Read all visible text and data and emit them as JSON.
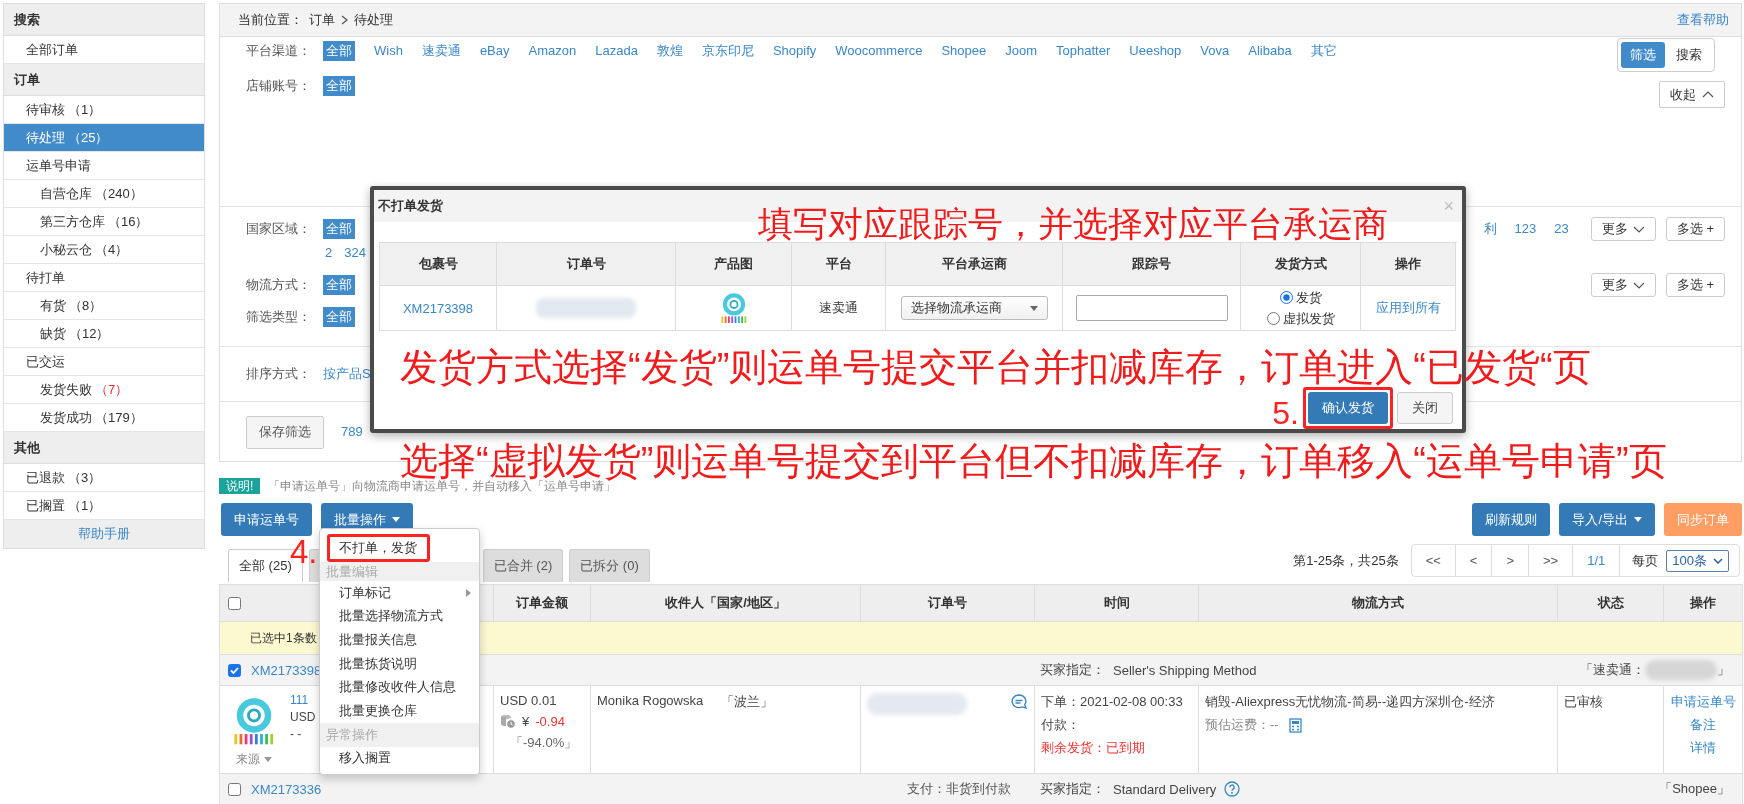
{
  "sidebar": {
    "sections": [
      {
        "title": "搜索",
        "items": [
          {
            "label": "全部订单",
            "selected": false,
            "alert": false
          }
        ]
      },
      {
        "title": "订单",
        "items": [
          {
            "label": "待审核",
            "count": "（1）",
            "selected": false,
            "alert": false
          },
          {
            "label": "待处理",
            "count": "（25）",
            "selected": true,
            "alert": false
          },
          {
            "label": "运单号申请",
            "selected": false,
            "alert": false,
            "children": [
              {
                "label": "自营仓库",
                "count": "（240）",
                "selected": false,
                "alert": false
              },
              {
                "label": "第三方仓库",
                "count": "（16）",
                "selected": false,
                "alert": false
              },
              {
                "label": "小秘云仓",
                "count": "（4）",
                "selected": false,
                "alert": false
              }
            ]
          },
          {
            "label": "待打单",
            "selected": false,
            "alert": false,
            "children": [
              {
                "label": "有货",
                "count": "（8）",
                "selected": false,
                "alert": false
              },
              {
                "label": "缺货",
                "count": "（12）",
                "selected": false,
                "alert": false
              }
            ]
          },
          {
            "label": "已交运",
            "selected": false,
            "alert": false,
            "children": [
              {
                "label": "发货失败",
                "count": "（7）",
                "selected": false,
                "alert": true
              },
              {
                "label": "发货成功",
                "count": "（179）",
                "selected": false,
                "alert": false
              }
            ]
          }
        ]
      },
      {
        "title": "其他",
        "items": [
          {
            "label": "已退款",
            "count": "（3）",
            "selected": false,
            "alert": false
          },
          {
            "label": "已搁置",
            "count": "（1）",
            "selected": false,
            "alert": false
          }
        ]
      }
    ],
    "help": "帮助手册"
  },
  "filters": {
    "breadcrumb": {
      "label": "当前位置：",
      "path": [
        "订单",
        "待处理"
      ]
    },
    "help": "查看帮助",
    "view_switch": [
      {
        "label": "筛选",
        "selected": true
      },
      {
        "label": "搜索",
        "selected": false
      }
    ],
    "collapse": "收起",
    "groups": [
      {
        "kind": "rows",
        "rows": [
          {
            "label": "平台渠道：",
            "options": [
              {
                "text": "全部",
                "selected": true
              },
              {
                "text": "Wish",
                "selected": false
              },
              {
                "text": "速卖通",
                "selected": false
              },
              {
                "text": "eBay",
                "selected": false
              },
              {
                "text": "Amazon",
                "selected": false
              },
              {
                "text": "Lazada",
                "selected": false
              },
              {
                "text": "敦煌",
                "selected": false
              },
              {
                "text": "京东印尼",
                "selected": false
              },
              {
                "text": "Shopify",
                "selected": false
              },
              {
                "text": "Woocommerce",
                "selected": false
              },
              {
                "text": "Shopee",
                "selected": false
              },
              {
                "text": "Joom",
                "selected": false
              },
              {
                "text": "Tophatter",
                "selected": false
              },
              {
                "text": "Ueeshop",
                "selected": false
              },
              {
                "text": "Vova",
                "selected": false
              },
              {
                "text": "Alibaba",
                "selected": false
              },
              {
                "text": "其它",
                "selected": false
              }
            ]
          },
          {
            "label": "店铺账号：",
            "options": [
              {
                "text": "全部",
                "selected": true
              }
            ]
          }
        ]
      },
      {
        "kind": "rows",
        "rows": [
          {
            "label": "国家区域：",
            "options": [
              {
                "text": "全部",
                "selected": true
              }
            ],
            "more_options": [
              "2",
              "324"
            ],
            "extra_options": [
              "利",
              "123",
              "23"
            ],
            "buttons": [
              {
                "label": "更多",
                "kind": "more"
              },
              {
                "label": "多选 +",
                "kind": "multi"
              }
            ]
          },
          {
            "label": "物流方式：",
            "options": [
              {
                "text": "全部",
                "selected": true
              }
            ],
            "buttons": [
              {
                "label": "更多",
                "kind": "more"
              },
              {
                "label": "多选 +",
                "kind": "multi"
              }
            ]
          },
          {
            "label": "筛选类型：",
            "options": [
              {
                "text": "全部",
                "selected": true
              }
            ]
          }
        ]
      },
      {
        "kind": "rows",
        "rows": [
          {
            "label": "排序方式：",
            "options": [
              {
                "text": "按产品S",
                "selected": false
              }
            ]
          }
        ]
      },
      {
        "kind": "save",
        "button": "保存筛选",
        "options": [
          "789"
        ]
      }
    ]
  },
  "dialog": {
    "title": "不打单发货",
    "close": "×",
    "columns": [
      "包裹号",
      "订单号",
      "产品图",
      "平台",
      "平台承运商",
      "跟踪号",
      "发货方式",
      "操作"
    ],
    "rows": [
      {
        "package": "XM2173398",
        "platform": "速卖通",
        "carrier": "选择物流承运商",
        "methods": [
          {
            "label": "发货",
            "selected": true
          },
          {
            "label": "虚拟发货",
            "selected": false
          }
        ],
        "action": "应用到所有"
      }
    ],
    "buttons": [
      {
        "label": "确认发货",
        "kind": "primary",
        "step": "5."
      },
      {
        "label": "关闭",
        "kind": "default"
      }
    ]
  },
  "annotations": [
    "填写对应跟踪号，并选择对应平台承运商",
    "发货方式选择“发货”则运单号提交平台并扣减库存，订单进入“已发货“页",
    "选择“虚拟发货”则运单号提交到平台但不扣减库存，订单移入“运单号申请”页"
  ],
  "note": {
    "badge": "说明!",
    "text": "「申请运单号」向物流商申请运单号，并自动移入「运单号申请」"
  },
  "toolbar": {
    "left": [
      {
        "label": "申请运单号",
        "kind": "primary",
        "dropdown": false
      },
      {
        "label": "批量操作",
        "kind": "primary",
        "dropdown": true
      }
    ],
    "right": [
      {
        "label": "刷新规则",
        "kind": "primary",
        "dropdown": false
      },
      {
        "label": "导入/导出",
        "kind": "primary",
        "dropdown": true
      },
      {
        "label": "同步订单",
        "kind": "warning",
        "dropdown": false
      }
    ]
  },
  "tabs": [
    {
      "label": "全部 (25)",
      "selected": true
    },
    {
      "label": "已合并 (2)",
      "selected": false
    },
    {
      "label": "已拆分 (0)",
      "selected": false
    }
  ],
  "pagination": {
    "summary": "第1-25条，共25条",
    "buttons": [
      "<<",
      "<",
      ">",
      ">>",
      "1/1"
    ],
    "per_page_label": "每页",
    "per_page": "100条"
  },
  "menu": {
    "items": [
      {
        "kind": "item",
        "label": "不打单，发货",
        "step": "4."
      },
      {
        "kind": "group",
        "label": "批量编辑"
      },
      {
        "kind": "item",
        "label": "订单标记",
        "submenu": true
      },
      {
        "kind": "item",
        "label": "批量选择物流方式"
      },
      {
        "kind": "item",
        "label": "批量报关信息"
      },
      {
        "kind": "item",
        "label": "批量拣货说明"
      },
      {
        "kind": "item",
        "label": "批量修改收件人信息"
      },
      {
        "kind": "item",
        "label": "批量更换仓库"
      },
      {
        "kind": "group",
        "label": "异常操作"
      },
      {
        "kind": "item",
        "label": "移入搁置"
      }
    ]
  },
  "table": {
    "all_checked": false,
    "columns": [
      "订单金额",
      "收件人「国家/地区」",
      "订单号",
      "时间",
      "物流方式",
      "状态",
      "操作"
    ],
    "selection_text": "已选中1条数",
    "orders": [
      {
        "id": "XM2173398",
        "checked": true,
        "buyer_label": "买家指定：",
        "buyer_method": "Seller's Shipping Method",
        "method_help": false,
        "store": "「速卖通：",
        "store_close": "」",
        "detail": {
          "product": {
            "title": "111",
            "price": "USD",
            "dash": "- -",
            "source": "来源"
          },
          "amount": {
            "total": "USD 0.01",
            "profit_currency": "¥",
            "profit": "-0.94",
            "margin": "「-94.0%」"
          },
          "recipient": "Monika Rogowska",
          "country": "「波兰」",
          "time": {
            "ordered": "下单：2021-02-08 00:33",
            "paid": "付款：",
            "remaining": "剩余发货：已到期"
          },
          "logistics": {
            "method": "销毁-Aliexpress无忧物流-简易--递四方深圳仓-经济",
            "estimate": "预估运费：--"
          },
          "status": "已审核",
          "actions": [
            "申请运单号",
            "备注",
            "详情"
          ]
        }
      },
      {
        "id": "XM2173336",
        "checked": false,
        "payment": "支付：非货到付款",
        "buyer_label": "买家指定：",
        "buyer_method": "Standard Delivery",
        "method_help": true,
        "store": "「Shopee」"
      }
    ]
  }
}
